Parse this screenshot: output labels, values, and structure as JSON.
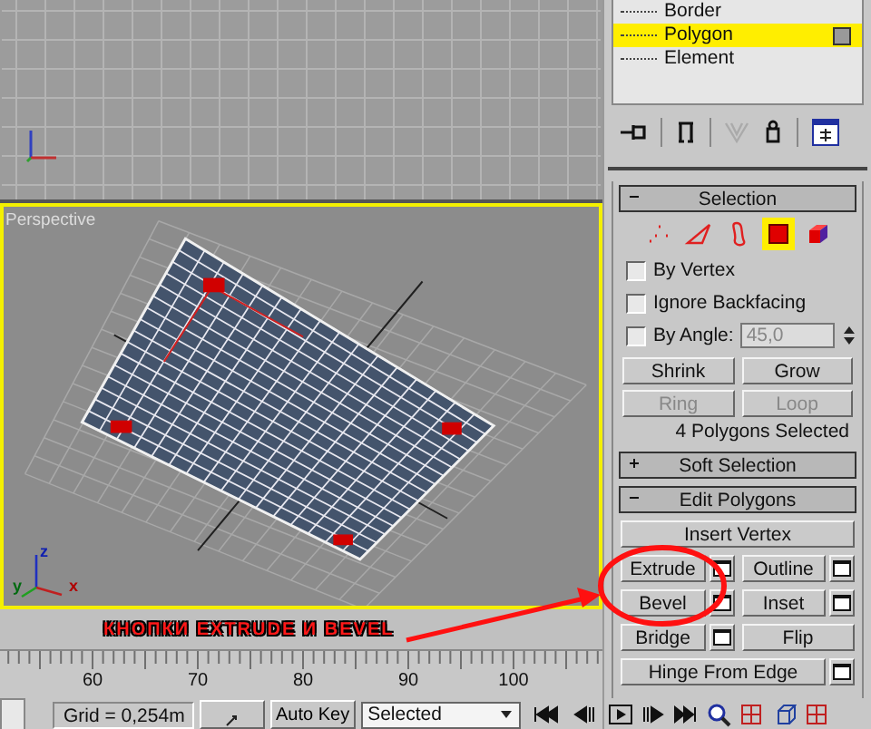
{
  "stack": {
    "items": [
      {
        "label": "Border",
        "selected": false
      },
      {
        "label": "Polygon",
        "selected": true
      },
      {
        "label": "Element",
        "selected": false
      }
    ]
  },
  "selection": {
    "title": "Selection",
    "expanded": true,
    "modes": [
      {
        "kind": "vertex",
        "selected": false
      },
      {
        "kind": "edge",
        "selected": false
      },
      {
        "kind": "border",
        "selected": false
      },
      {
        "kind": "polygon",
        "selected": true
      },
      {
        "kind": "element",
        "selected": false
      }
    ],
    "options": [
      {
        "label": "By Vertex",
        "checked": false
      },
      {
        "label": "Ignore Backfacing",
        "checked": false
      },
      {
        "label": "By Angle:",
        "checked": false
      }
    ],
    "angle": "45,0",
    "buttons": [
      {
        "label": "Shrink",
        "disabled": false
      },
      {
        "label": "Grow",
        "disabled": false
      },
      {
        "label": "Ring",
        "disabled": true
      },
      {
        "label": "Loop",
        "disabled": true
      }
    ],
    "status": "4 Polygons Selected"
  },
  "soft_selection": {
    "title": "Soft Selection",
    "expanded": false
  },
  "edit_polygons": {
    "title": "Edit Polygons",
    "expanded": true,
    "buttons": [
      {
        "label": "Insert Vertex",
        "kind": "wide",
        "settings": false
      },
      {
        "label": "Extrude",
        "kind": "half",
        "settings": true
      },
      {
        "label": "Outline",
        "kind": "half",
        "settings": true
      },
      {
        "label": "Bevel",
        "kind": "half",
        "settings": true
      },
      {
        "label": "Inset",
        "kind": "half",
        "settings": true
      },
      {
        "label": "Bridge",
        "kind": "half",
        "settings": true
      },
      {
        "label": "Flip",
        "kind": "half",
        "settings": false
      },
      {
        "label": "Hinge From Edge",
        "kind": "wide",
        "settings": true
      }
    ]
  },
  "viewport": {
    "label": "Perspective",
    "active": true,
    "axes": {
      "z": "z",
      "y": "y",
      "x": "x"
    }
  },
  "annotation": {
    "text": "КНОПКИ EXTRUDE И BEVEL"
  },
  "timeline": {
    "ticks": [
      "60",
      "70",
      "80",
      "90",
      "100"
    ]
  },
  "status_bar": {
    "grid": "Grid = 0,254m",
    "auto_key": "Auto Key",
    "key_mode": "Selected"
  }
}
